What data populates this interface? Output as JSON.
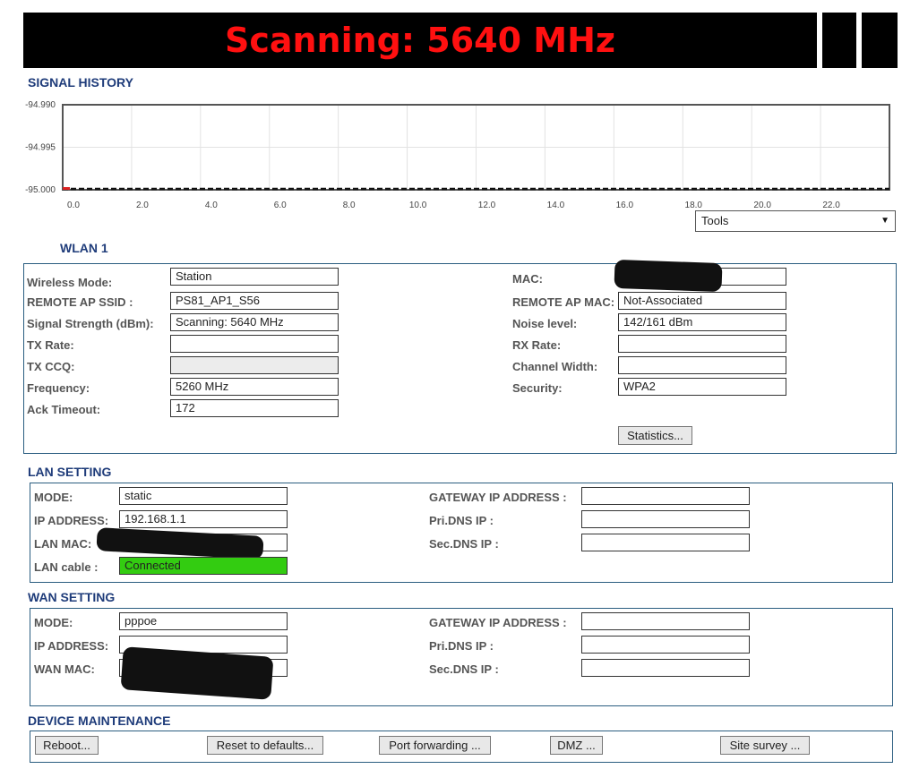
{
  "header": {
    "title": "Scanning: 5640 MHz"
  },
  "signal_history": {
    "title": "SIGNAL HISTORY",
    "chart_data": {
      "type": "line",
      "title": "",
      "xlabel": "",
      "ylabel": "",
      "x_ticks": [
        "0.0",
        "2.0",
        "4.0",
        "6.0",
        "8.0",
        "10.0",
        "12.0",
        "14.0",
        "16.0",
        "18.0",
        "20.0",
        "22.0"
      ],
      "y_ticks": [
        "-94.990",
        "-94.995",
        "-95.000"
      ],
      "xlim": [
        0,
        24
      ],
      "ylim": [
        -95.0,
        -94.99
      ],
      "grid": true,
      "series": [
        {
          "color": "#111111",
          "style": "dashed",
          "points": [
            [
              0,
              -95.0
            ],
            [
              2,
              -95.0
            ],
            [
              4,
              -95.0
            ],
            [
              6,
              -95.0
            ],
            [
              8,
              -95.0
            ],
            [
              10,
              -95.0
            ],
            [
              12,
              -95.0
            ],
            [
              14,
              -95.0
            ],
            [
              16,
              -95.0
            ],
            [
              18,
              -95.0
            ],
            [
              20,
              -95.0
            ],
            [
              22,
              -95.0
            ],
            [
              24,
              -95.0
            ]
          ]
        }
      ],
      "marker_color": "#dd2222"
    },
    "tools": {
      "label": "Tools"
    }
  },
  "wlan": {
    "title": "WLAN 1",
    "wireless_mode": {
      "label": "Wireless Mode:",
      "value": "Station"
    },
    "remote_ap_ssid": {
      "label": "REMOTE AP SSID :",
      "value": "PS81_AP1_S56"
    },
    "signal_strength": {
      "label": "Signal Strength (dBm):",
      "value": "Scanning: 5640 MHz"
    },
    "tx_rate": {
      "label": "TX Rate:",
      "value": ""
    },
    "tx_ccq": {
      "label": "TX CCQ:",
      "value": ""
    },
    "frequency": {
      "label": "Frequency:",
      "value": "5260 MHz"
    },
    "ack_timeout": {
      "label": "Ack Timeout:",
      "value": "172"
    },
    "mac": {
      "label": "MAC:",
      "value": ""
    },
    "remote_ap_mac": {
      "label": "REMOTE AP MAC:",
      "value": "Not-Associated"
    },
    "noise_level": {
      "label": "Noise level:",
      "value": "142/161 dBm"
    },
    "rx_rate": {
      "label": "RX Rate:",
      "value": ""
    },
    "channel_width": {
      "label": "Channel Width:",
      "value": ""
    },
    "security": {
      "label": "Security:",
      "value": "WPA2"
    },
    "statistics_button": "Statistics..."
  },
  "lan": {
    "title": "LAN SETTING",
    "mode": {
      "label": "MODE:",
      "value": "static"
    },
    "ip_address": {
      "label": "IP ADDRESS:",
      "value": "192.168.1.1"
    },
    "lan_mac": {
      "label": "LAN MAC:",
      "value": ""
    },
    "lan_cable": {
      "label": "LAN cable :",
      "value": "Connected"
    },
    "gateway": {
      "label": "GATEWAY IP ADDRESS :",
      "value": ""
    },
    "pri_dns": {
      "label": "Pri.DNS IP :",
      "value": ""
    },
    "sec_dns": {
      "label": "Sec.DNS IP :",
      "value": ""
    }
  },
  "wan": {
    "title": "WAN SETTING",
    "mode": {
      "label": "MODE:",
      "value": "pppoe"
    },
    "ip_address": {
      "label": "IP ADDRESS:",
      "value": ""
    },
    "wan_mac": {
      "label": "WAN MAC:",
      "value": ""
    },
    "gateway": {
      "label": "GATEWAY IP ADDRESS :",
      "value": ""
    },
    "pri_dns": {
      "label": "Pri.DNS IP :",
      "value": ""
    },
    "sec_dns": {
      "label": "Sec.DNS IP :",
      "value": ""
    }
  },
  "maintenance": {
    "title": "DEVICE MAINTENANCE",
    "reboot": "Reboot...",
    "reset": "Reset to defaults...",
    "port_forwarding": "Port forwarding ...",
    "dmz": "DMZ ...",
    "site_survey": "Site survey ..."
  },
  "colors": {
    "header_text": "#ff1010",
    "section_title": "#1f3c7a",
    "connected": "#33cc11",
    "panel_border": "#2a5d80"
  }
}
